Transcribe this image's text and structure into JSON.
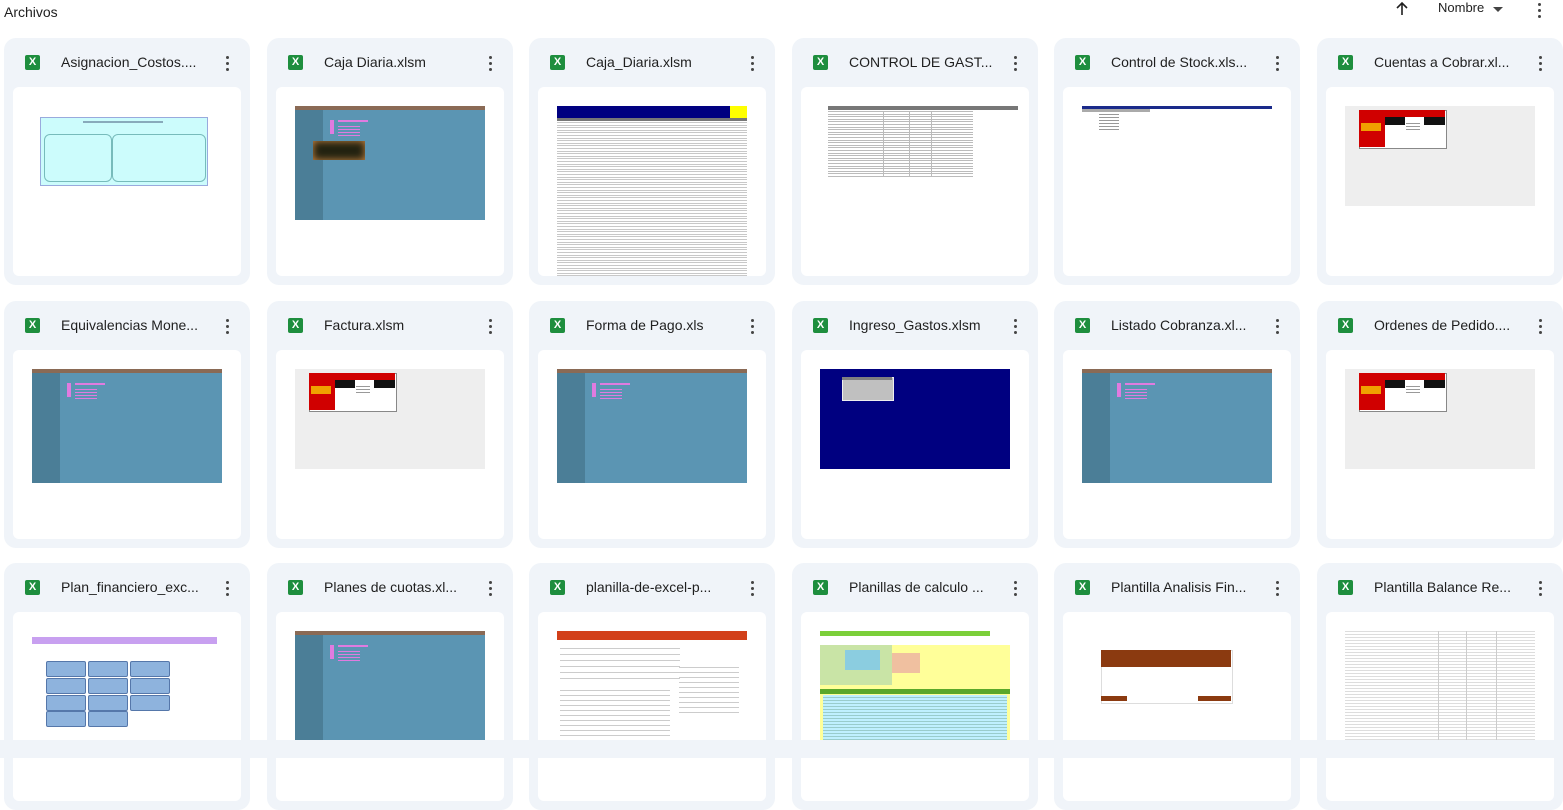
{
  "header": {
    "section_title": "Archivos",
    "sort_label": "Nombre",
    "sort_direction_icon": "arrow-up-icon",
    "more_icon": "more-vert-icon"
  },
  "files": [
    {
      "name": "Asignacion_Costos....",
      "icon": "excel-icon",
      "thumb": "cyan-boxes"
    },
    {
      "name": "Caja Diaria.xlsm",
      "icon": "excel-icon",
      "thumb": "teal-sheet-image"
    },
    {
      "name": "Caja_Diaria.xlsm",
      "icon": "excel-icon",
      "thumb": "blue-header-table"
    },
    {
      "name": "CONTROL DE GAST...",
      "icon": "excel-icon",
      "thumb": "grey-table"
    },
    {
      "name": "Control de Stock.xls...",
      "icon": "excel-icon",
      "thumb": "blue-line-list"
    },
    {
      "name": "Cuentas a Cobrar.xl...",
      "icon": "excel-icon",
      "thumb": "red-menu"
    },
    {
      "name": "Equivalencias Mone...",
      "icon": "excel-icon",
      "thumb": "teal-sheet"
    },
    {
      "name": "Factura.xlsm",
      "icon": "excel-icon",
      "thumb": "red-menu"
    },
    {
      "name": "Forma de Pago.xls",
      "icon": "excel-icon",
      "thumb": "teal-sheet"
    },
    {
      "name": "Ingreso_Gastos.xlsm",
      "icon": "excel-icon",
      "thumb": "navy-dialog"
    },
    {
      "name": "Listado Cobranza.xl...",
      "icon": "excel-icon",
      "thumb": "teal-sheet"
    },
    {
      "name": "Ordenes de Pedido....",
      "icon": "excel-icon",
      "thumb": "red-menu"
    },
    {
      "name": "Plan_financiero_exc...",
      "icon": "excel-icon",
      "thumb": "purple-buttons"
    },
    {
      "name": "Planes de cuotas.xl...",
      "icon": "excel-icon",
      "thumb": "teal-sheet"
    },
    {
      "name": "planilla-de-excel-p...",
      "icon": "excel-icon",
      "thumb": "orange-doc"
    },
    {
      "name": "Planillas de calculo ...",
      "icon": "excel-icon",
      "thumb": "green-yellow-table"
    },
    {
      "name": "Plantilla Analisis Fin...",
      "icon": "excel-icon",
      "thumb": "brown-banner"
    },
    {
      "name": "Plantilla Balance Re...",
      "icon": "excel-icon",
      "thumb": "numbers-table"
    }
  ],
  "colors": {
    "card_bg": "#f0f4f9",
    "excel_green": "#1e8e3e",
    "teal": "#5b95b3",
    "navy": "#000080"
  }
}
